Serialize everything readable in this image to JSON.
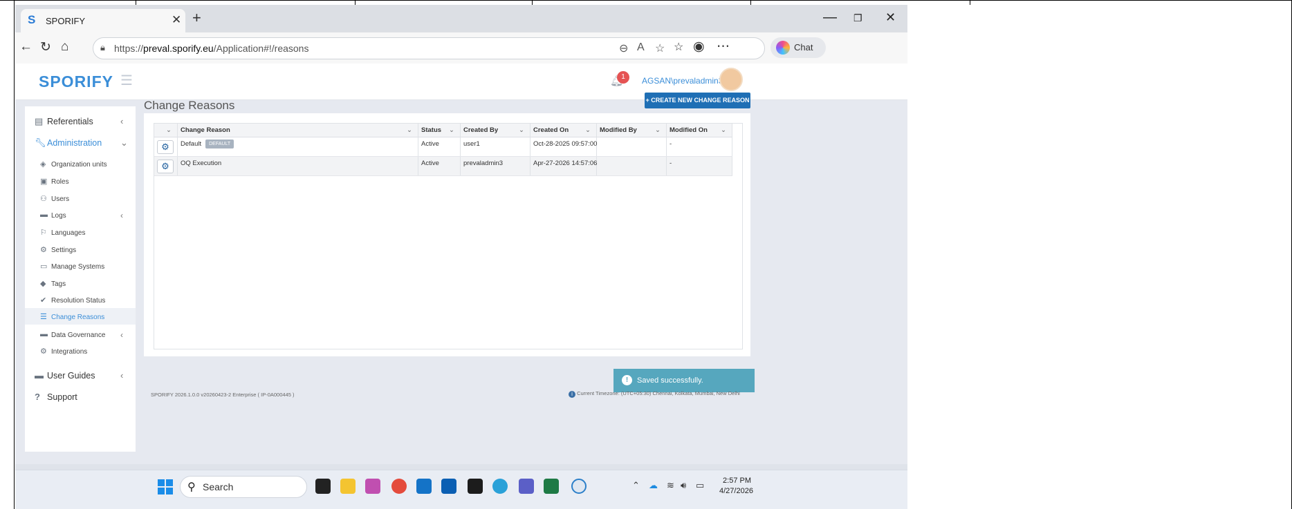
{
  "browser": {
    "tab_title": "SPORIFY",
    "tab_logo": "S",
    "url_prefix": "https://",
    "url_host": "preval.sporify.eu",
    "url_path": "/Application#!/reasons",
    "chat_label": "Chat"
  },
  "header": {
    "brand": "SPORIFY",
    "notification_count": "1",
    "username": "AGSAN\\prevaladmin3"
  },
  "sidebar": {
    "referentials": "Referentials",
    "administration": "Administration",
    "sub_items": [
      {
        "label": "Organization units",
        "icon": "layers-icon"
      },
      {
        "label": "Roles",
        "icon": "id-card-icon"
      },
      {
        "label": "Users",
        "icon": "users-icon"
      },
      {
        "label": "Logs",
        "icon": "book-icon"
      },
      {
        "label": "Languages",
        "icon": "flag-icon"
      },
      {
        "label": "Settings",
        "icon": "gear-icon"
      },
      {
        "label": "Manage Systems",
        "icon": "laptop-icon"
      },
      {
        "label": "Tags",
        "icon": "tags-icon"
      },
      {
        "label": "Resolution Status",
        "icon": "check-icon"
      },
      {
        "label": "Change Reasons",
        "icon": "list-icon"
      },
      {
        "label": "Data Governance",
        "icon": "book-icon"
      },
      {
        "label": "Integrations",
        "icon": "cogs-icon"
      }
    ],
    "user_guides": "User Guides",
    "support": "Support"
  },
  "page": {
    "title": "Change Reasons",
    "create_button": "CREATE NEW CHANGE REASON"
  },
  "table": {
    "columns": [
      "Change Reason",
      "Status",
      "Created By",
      "Created On",
      "Modified By",
      "Modified On"
    ],
    "rows": [
      {
        "reason": "Default",
        "tag": "DEFAULT",
        "status": "Active",
        "created_by": "user1",
        "created_on": "Oct-28-2025 09:57:00",
        "modified_by": "",
        "modified_on": "-"
      },
      {
        "reason": "OQ Execution",
        "tag": "",
        "status": "Active",
        "created_by": "prevaladmin3",
        "created_on": "Apr-27-2026 14:57:06",
        "modified_by": "",
        "modified_on": "-"
      }
    ]
  },
  "toast": {
    "message": "Saved successfully."
  },
  "footer": {
    "version": "SPORIFY 2026.1.0.0 v20260423-2 Enterprise ( IP-0A000445 )",
    "timezone": "Current Timezone: (UTC+05:30) Chennai, Kolkata, Mumbai, New Delhi"
  },
  "taskbar": {
    "search_label": "Search",
    "time": "2:57 PM",
    "date": "4/27/2026"
  },
  "colors": {
    "accent": "#1f6fb5",
    "brand": "#3b8ed8",
    "toast": "#56a7be",
    "badge": "#e55353"
  }
}
